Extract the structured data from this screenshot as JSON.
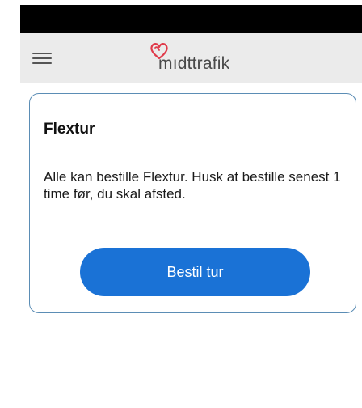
{
  "header": {
    "menu_icon": "hamburger-menu-icon",
    "logo_icon": "midttrafik-heart-icon",
    "logo_text": "mıdttrafik",
    "logo_color": "#e03a4a"
  },
  "card": {
    "title": "Flextur",
    "body": "Alle kan bestille Flextur. Husk at bestille senest 1 time før, du skal afsted.",
    "button_label": "Bestil tur",
    "border_color": "#5b8db5",
    "button_color": "#1a72d6"
  }
}
